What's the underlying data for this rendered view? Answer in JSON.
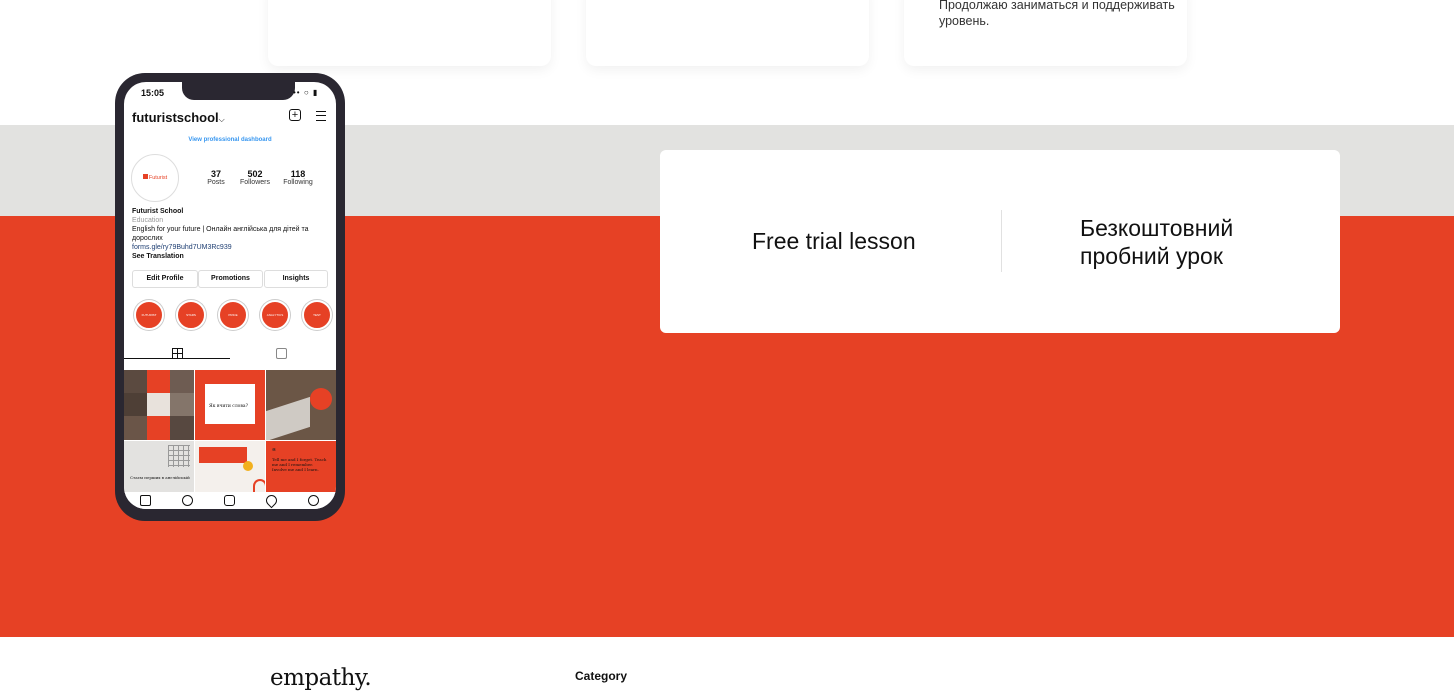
{
  "top_cards": {
    "third_card_text": "Продолжаю заниматься и поддерживать уровень."
  },
  "trial_card": {
    "label_en": "Free trial lesson",
    "label_ua": "Безкоштовний пробний урок"
  },
  "phone": {
    "status_time": "15:05",
    "status_icons": "•• ○ ▮",
    "username": "futuristschool",
    "username_chevron": "⌵",
    "dashboard_link": "View professional dashboard",
    "avatar_text": "Futurist",
    "stats": [
      {
        "value": "37",
        "label": "Posts"
      },
      {
        "value": "502",
        "label": "Followers"
      },
      {
        "value": "118",
        "label": "Following"
      }
    ],
    "bio": {
      "name": "Futurist School",
      "category": "Education",
      "description": "English for your future | Онлайн англійська для дітей та дорослих",
      "link": "forms.gle/ry79Buhd7UM3Rc939",
      "see_translation": "See Translation"
    },
    "profile_buttons": [
      "Edit Profile",
      "Promotions",
      "Insights"
    ],
    "highlight_labels": [
      "FUTURIST",
      "STARS",
      "PRICE",
      "ANALYTICS",
      "TEST"
    ],
    "tiles": {
      "quote_text": "Tell me and I forget. Teach me and I remember. Involve me and I learn.",
      "post_caption": "Як вчити слова?",
      "stats_caption": "Стаєм перших в англійській"
    }
  },
  "footer": {
    "brand": "empathy.",
    "category_heading": "Category"
  },
  "colors": {
    "accent_red": "#e64125",
    "gray_band": "#e2e2e0",
    "phone_frame": "#2a2731"
  }
}
